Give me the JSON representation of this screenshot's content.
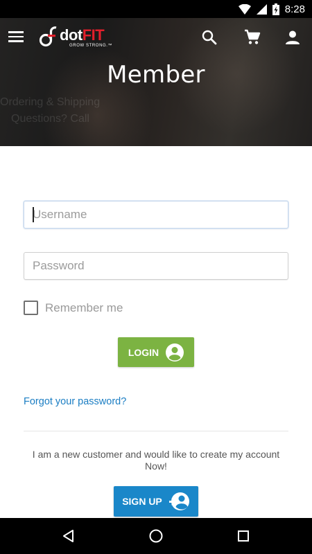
{
  "status_bar": {
    "time": "8:28",
    "icons": [
      "wifi-icon",
      "cell-signal-icon",
      "battery-charging-icon"
    ]
  },
  "header": {
    "brand_dot": "dot",
    "brand_fit": "FIT",
    "tagline": "GROW STRONG.™",
    "title": "Member",
    "background_text": [
      "Ordering & Shipping",
      "Questions? Call"
    ],
    "icons": {
      "menu": "menu-icon",
      "search": "search-icon",
      "cart": "cart-icon",
      "account": "account-icon"
    }
  },
  "form": {
    "username_placeholder": "Username",
    "password_placeholder": "Password",
    "remember_label": "Remember me",
    "login_label": "LOGIN",
    "forgot_label": "Forgot your password?",
    "new_customer_text": "I am a new customer and would like to create my account Now!",
    "signup_label": "SIGN UP"
  },
  "colors": {
    "login_green": "#7cb342",
    "signup_blue": "#1a87c9",
    "link_blue": "#1a7dc3",
    "brand_red": "#e11f2b"
  },
  "nav_bar": {
    "icons": [
      "back-icon",
      "home-icon",
      "recents-icon"
    ]
  }
}
